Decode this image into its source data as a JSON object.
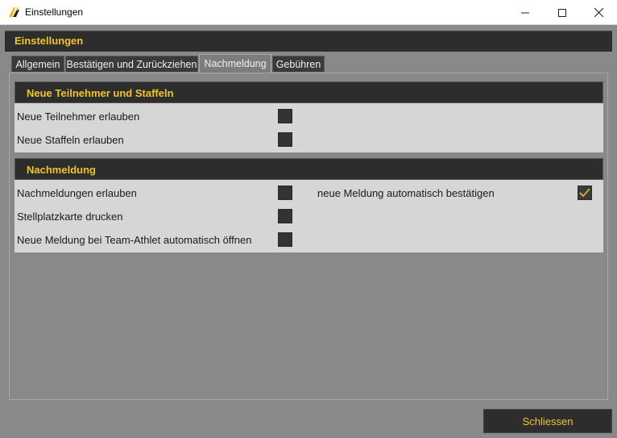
{
  "window": {
    "title": "Einstellungen",
    "icon": "app-logo-icon"
  },
  "header": {
    "title": "Einstellungen"
  },
  "tabs": [
    {
      "label": "Allgemein",
      "active": false
    },
    {
      "label": "Bestätigen und Zurückziehen",
      "active": false
    },
    {
      "label": "Nachmeldung",
      "active": true
    },
    {
      "label": "Gebühren",
      "active": false
    }
  ],
  "groups": {
    "new_participants": {
      "title": "Neue Teilnehmer und Staffeln",
      "items": [
        {
          "label": "Neue Teilnehmer erlauben",
          "checked": false
        },
        {
          "label": "Neue Staffeln erlauben",
          "checked": false
        }
      ]
    },
    "late_entry": {
      "title": "Nachmeldung",
      "items": [
        {
          "label": "Nachmeldungen erlauben",
          "checked": false
        },
        {
          "label": "Stellplatzkarte drucken",
          "checked": false
        },
        {
          "label": "Neue Meldung bei Team-Athlet automatisch öffnen",
          "checked": false
        }
      ],
      "right_items": [
        {
          "label": "neue Meldung automatisch bestätigen",
          "checked": true
        }
      ]
    }
  },
  "footer": {
    "close_label": "Schliessen"
  },
  "colors": {
    "accent": "#f2c42c",
    "dark": "#2d2d2d",
    "panel": "#d6d6d6",
    "background": "#898989"
  }
}
